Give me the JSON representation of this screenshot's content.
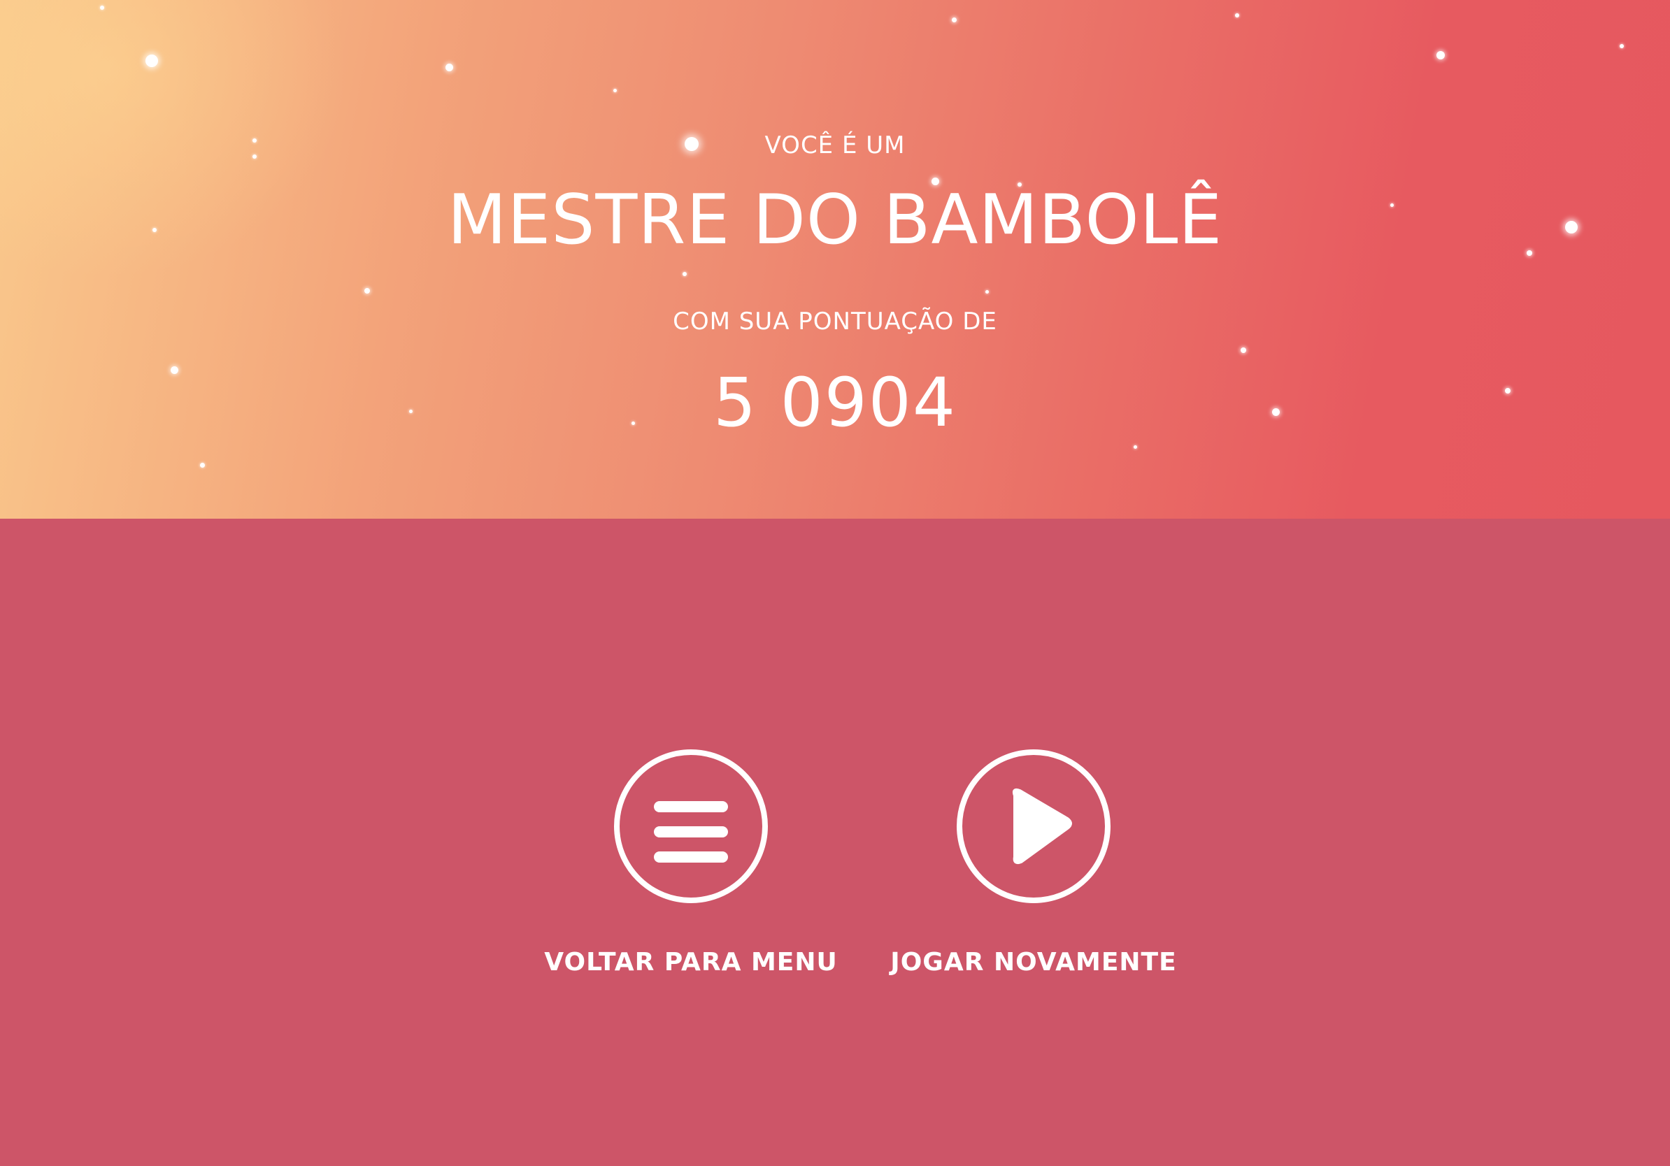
{
  "result": {
    "eyebrow": "VOCÊ É UM",
    "rank_title": "MESTRE DO BAMBOLÊ",
    "score_caption": "COM SUA PONTUAÇÃO DE",
    "score_value": "5 0904"
  },
  "actions": {
    "menu_label": "VOLTAR PARA MENU",
    "menu_icon": "hamburger-menu-icon",
    "replay_label": "JOGAR NOVAMENTE",
    "replay_icon": "play-icon"
  },
  "colors": {
    "hero_gradient_start": "#fac98c",
    "hero_gradient_end": "#e6585f",
    "lower_background": "#cd5568",
    "text": "#ffffff"
  }
}
